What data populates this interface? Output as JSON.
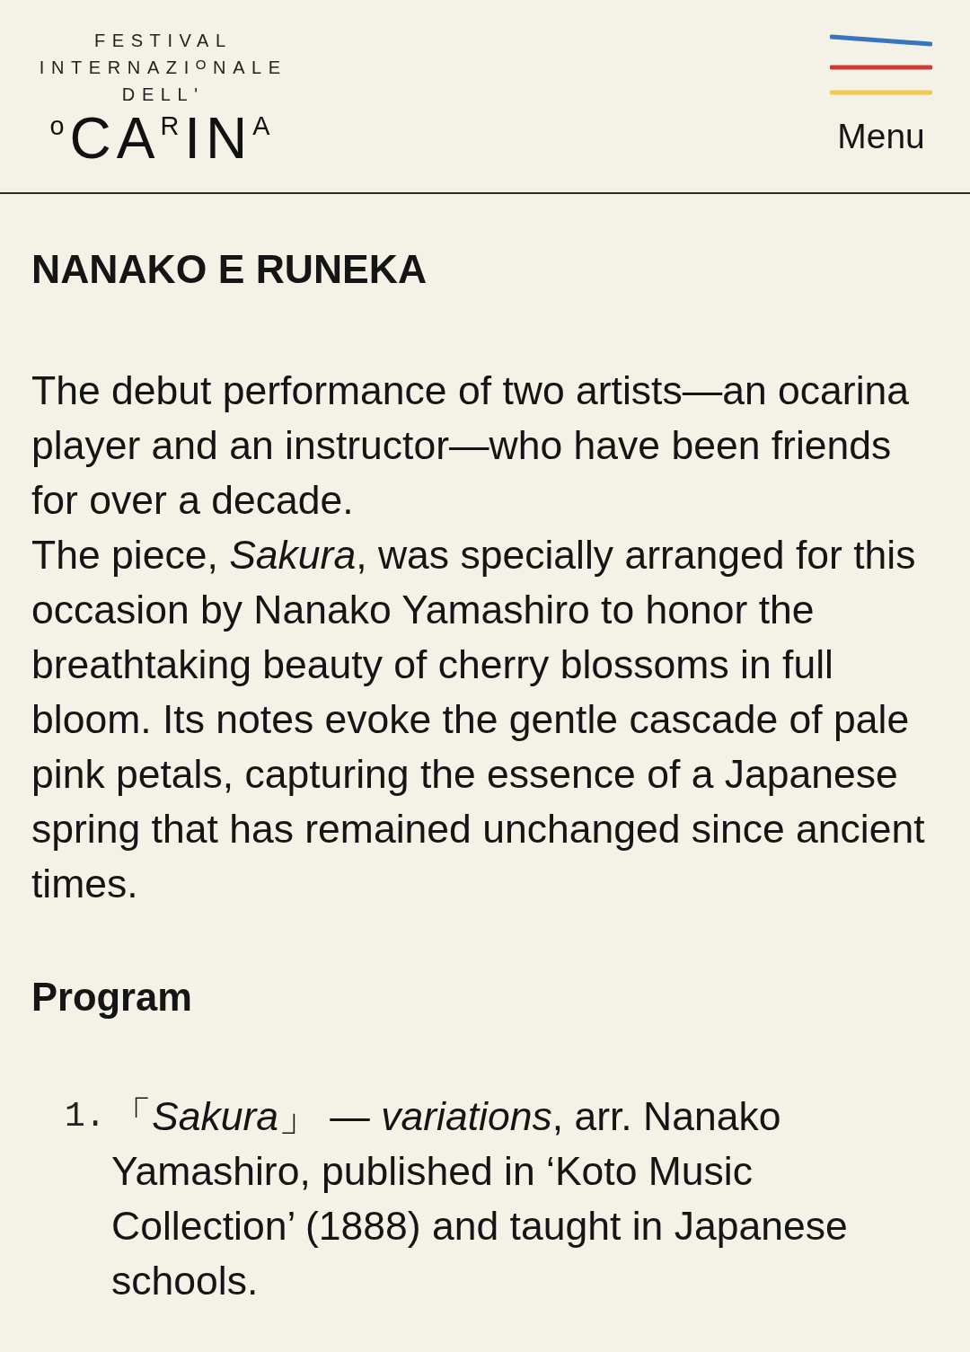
{
  "header": {
    "logo": {
      "top_lines": [
        "FESTIVAL",
        "INTERNAZI$^{O}$NALE",
        "DELL'"
      ],
      "name": "$^{o}$CA$^{R}$IN$^{A}$"
    },
    "menu": {
      "label": "Menu"
    }
  },
  "article": {
    "title": "NANAKO E RUNEKA",
    "paragraphs": [
      "The debut performance of two artists—an ocarina player and an instructor—who have been friends for over a decade.",
      "The piece, *Sakura*, was specially arranged for this occasion by Nanako Yamashiro to honor the breathtaking beauty of cherry blossoms in full bloom. Its notes evoke the gentle cascade of pale pink petals, capturing the essence of a Japanese spring that has remained unchanged since ancient times."
    ]
  },
  "program": {
    "heading": "Program",
    "items": [
      {
        "number": "1.",
        "text": "「*Sakura*」 — *variations*, arr. Nanako Yamashiro, published in ‘Koto Music Collection’ (1888) and taught in Japanese schools."
      }
    ]
  }
}
